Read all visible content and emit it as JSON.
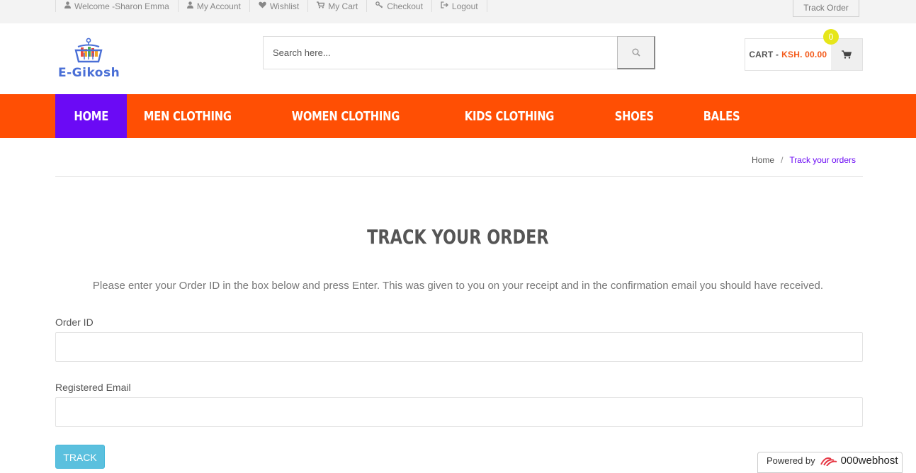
{
  "topbar": {
    "items": [
      {
        "label": "Welcome -Sharon Emma",
        "icon": "user-icon"
      },
      {
        "label": "My Account",
        "icon": "user-icon"
      },
      {
        "label": "Wishlist",
        "icon": "heart-icon"
      },
      {
        "label": "My Cart",
        "icon": "cart-icon"
      },
      {
        "label": "Checkout",
        "icon": "key-icon"
      },
      {
        "label": "Logout",
        "icon": "sign-out-icon"
      }
    ],
    "track_order": "Track Order"
  },
  "logo": {
    "text": "E-Gikosh"
  },
  "search": {
    "placeholder": "Search here...",
    "value": ""
  },
  "cart": {
    "label": "CART -",
    "amount": "KSH. 00.00",
    "count": "0"
  },
  "nav": {
    "items": [
      "HOME",
      "MEN CLOTHING",
      "WOMEN CLOTHING",
      "KIDS CLOTHING",
      "SHOES",
      "BALES"
    ],
    "active": "HOME"
  },
  "breadcrumb": {
    "home": "Home",
    "separator": "/",
    "current": "Track your orders"
  },
  "page": {
    "title": "TRACK YOUR ORDER",
    "intro": "Please enter your Order ID in the box below and press Enter. This was given to you on your receipt and in the confirmation email you should have received.",
    "order_id_label": "Order ID",
    "order_id_value": "",
    "email_label": "Registered Email",
    "email_value": "",
    "submit": "TRACK"
  },
  "powered": {
    "prefix": "Powered by",
    "brand": "000webhost"
  },
  "colors": {
    "accent": "#ff4f04",
    "active_nav": "#6b0af5",
    "button": "#5bc0de",
    "badge": "#e6e61a"
  }
}
